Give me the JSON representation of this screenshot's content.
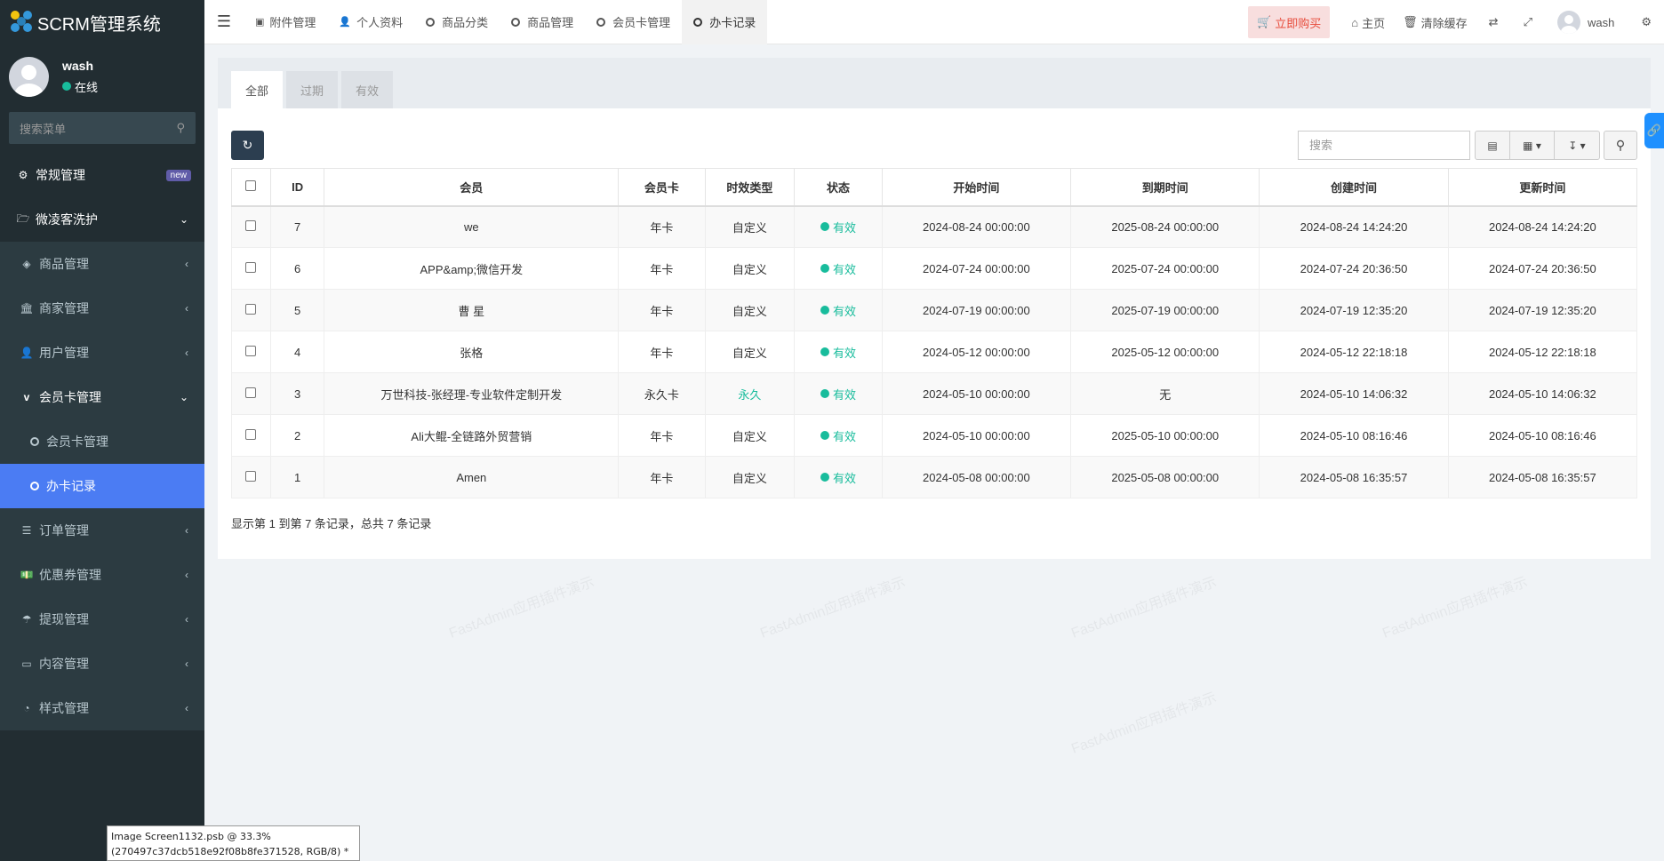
{
  "app": {
    "title": "SCRM管理系统"
  },
  "user": {
    "name": "wash",
    "status": "在线"
  },
  "sidebar": {
    "search_placeholder": "搜索菜单",
    "items": [
      {
        "label": "常规管理",
        "badge": "new"
      },
      {
        "label": "微凌客洗护"
      },
      {
        "label": "商品管理"
      },
      {
        "label": "商家管理"
      },
      {
        "label": "用户管理"
      },
      {
        "label": "会员卡管理"
      },
      {
        "label": "会员卡管理"
      },
      {
        "label": "办卡记录"
      },
      {
        "label": "订单管理"
      },
      {
        "label": "优惠券管理"
      },
      {
        "label": "提现管理"
      },
      {
        "label": "内容管理"
      },
      {
        "label": "样式管理"
      }
    ]
  },
  "header": {
    "tabs": [
      {
        "label": "附件管理"
      },
      {
        "label": "个人资料"
      },
      {
        "label": "商品分类"
      },
      {
        "label": "商品管理"
      },
      {
        "label": "会员卡管理"
      },
      {
        "label": "办卡记录"
      }
    ],
    "buy_label": "立即购买",
    "home_label": "主页",
    "clear_cache_label": "清除缓存",
    "user_name": "wash"
  },
  "panel": {
    "tabs": [
      {
        "label": "全部"
      },
      {
        "label": "过期"
      },
      {
        "label": "有效"
      }
    ],
    "search_placeholder": "搜索"
  },
  "table": {
    "headers": [
      "ID",
      "会员",
      "会员卡",
      "时效类型",
      "状态",
      "开始时间",
      "到期时间",
      "创建时间",
      "更新时间"
    ],
    "rows": [
      {
        "id": "7",
        "member": "we",
        "card": "年卡",
        "type": "自定义",
        "status": "有效",
        "start": "2024-08-24 00:00:00",
        "end": "2025-08-24 00:00:00",
        "created": "2024-08-24 14:24:20",
        "updated": "2024-08-24 14:24:20"
      },
      {
        "id": "6",
        "member": "APP&amp;微信开发",
        "card": "年卡",
        "type": "自定义",
        "status": "有效",
        "start": "2024-07-24 00:00:00",
        "end": "2025-07-24 00:00:00",
        "created": "2024-07-24 20:36:50",
        "updated": "2024-07-24 20:36:50"
      },
      {
        "id": "5",
        "member": "曹 星",
        "card": "年卡",
        "type": "自定义",
        "status": "有效",
        "start": "2024-07-19 00:00:00",
        "end": "2025-07-19 00:00:00",
        "created": "2024-07-19 12:35:20",
        "updated": "2024-07-19 12:35:20"
      },
      {
        "id": "4",
        "member": "张格",
        "card": "年卡",
        "type": "自定义",
        "status": "有效",
        "start": "2024-05-12 00:00:00",
        "end": "2025-05-12 00:00:00",
        "created": "2024-05-12 22:18:18",
        "updated": "2024-05-12 22:18:18"
      },
      {
        "id": "3",
        "member": "万世科技-张经理-专业软件定制开发",
        "card": "永久卡",
        "type": "永久",
        "status": "有效",
        "start": "2024-05-10 00:00:00",
        "end": "无",
        "created": "2024-05-10 14:06:32",
        "updated": "2024-05-10 14:06:32"
      },
      {
        "id": "2",
        "member": "Ali大鲲-全链路外贸营销",
        "card": "年卡",
        "type": "自定义",
        "status": "有效",
        "start": "2024-05-10 00:00:00",
        "end": "2025-05-10 00:00:00",
        "created": "2024-05-10 08:16:46",
        "updated": "2024-05-10 08:16:46"
      },
      {
        "id": "1",
        "member": "Amen",
        "card": "年卡",
        "type": "自定义",
        "status": "有效",
        "start": "2024-05-08 00:00:00",
        "end": "2025-05-08 00:00:00",
        "created": "2024-05-08 16:35:57",
        "updated": "2024-05-08 16:35:57"
      }
    ],
    "pagination_info": "显示第 1 到第 7 条记录，总共 7 条记录"
  },
  "watermark": "FastAdmin应用插件演示",
  "psb_tooltip": {
    "line1": "Image Screen1132.psb @ 33.3%",
    "line2": "(270497c37dcb518e92f08b8fe371528, RGB/8) *"
  },
  "colors": {
    "sidebar_bg": "#222d32",
    "active_menu": "#4b7cf3",
    "accent_green": "#18bc9c",
    "buy_red": "#e74c3c"
  }
}
